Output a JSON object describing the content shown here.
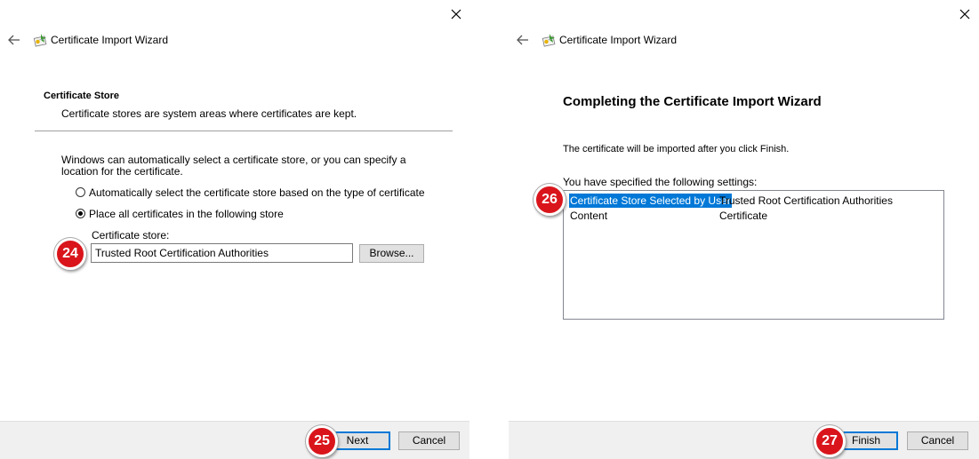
{
  "left_window": {
    "title": "Certificate Import Wizard",
    "section_heading": "Certificate Store",
    "section_description": "Certificate stores are system areas where certificates are kept.",
    "intro_text": "Windows can automatically select a certificate store, or you can specify a location for the certificate.",
    "radio_auto_label": "Automatically select the certificate store based on the type of certificate",
    "radio_place_label": "Place all certificates in the following store",
    "radio_selected": "place",
    "store_field_label": "Certificate store:",
    "store_field_value": "Trusted Root Certification Authorities",
    "browse_label": "Browse...",
    "next_label": "Next",
    "cancel_label": "Cancel",
    "badge_store": "24",
    "badge_next": "25"
  },
  "right_window": {
    "title": "Certificate Import Wizard",
    "heading": "Completing the Certificate Import Wizard",
    "info_text": "The certificate will be imported after you click Finish.",
    "settings_label": "You have specified the following settings:",
    "settings": [
      {
        "key": "Certificate Store Selected by User",
        "value": "Trusted Root Certification Authorities",
        "selected": true
      },
      {
        "key": "Content",
        "value": "Certificate",
        "selected": false
      }
    ],
    "finish_label": "Finish",
    "cancel_label": "Cancel",
    "badge_settings": "26",
    "badge_finish": "27"
  },
  "colors": {
    "badge_red": "#d9151b",
    "selection_blue": "#0078d7",
    "footer_gray": "#f0f0f0",
    "button_gray": "#e1e1e1"
  },
  "icons": {
    "close": "close-icon",
    "back": "back-arrow-icon",
    "certificate": "certificate-wizard-icon"
  }
}
